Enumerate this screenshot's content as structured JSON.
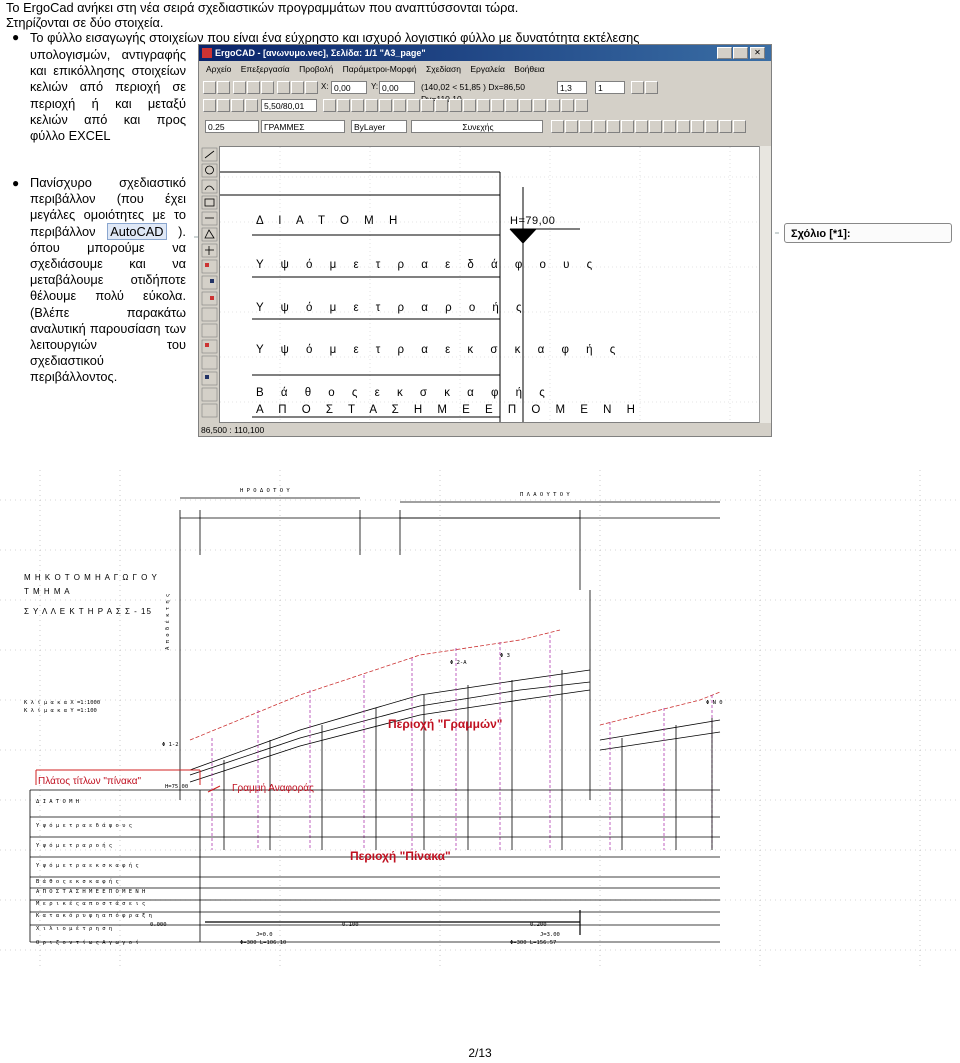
{
  "intro": {
    "line1": "Το ErgoCad  ανήκει στη νέα σειρά σχεδιαστικών προγραμμάτων που αναπτύσσονται τώρα.",
    "line2": "Στηρίζονται σε δύο στοιχεία.",
    "bullet1_first": "Το φύλλο εισαγωγής στοιχείων που είναι ένα εύχρηστο και ισχυρό λογιστικό φύλλο με δυνατότητα εκτέλεσης",
    "bullet1_rest": "υπολογισμών, αντιγραφής και επικόλλησης στοιχείων κελιών από περιοχή σε περιοχή ή και μεταξύ κελιών από και προς φύλλο EXCEL",
    "bullet2_pre": "Πανίσχυρο σχεδιαστικό περιβάλλον (που έχει μεγάλες ομοιότητες με το περιβάλλον",
    "bullet2_hl": "AutoCAD",
    "bullet2_post": "). όπου μπορούμε να σχεδιάσουμε και να μεταβάλουμε οτιδήποτε θέλουμε πολύ εύκολα. (Βλέπε παρακάτω αναλυτική παρουσίαση των λειτουργιών του σχεδιαστικού περιβάλλοντος."
  },
  "comment": "Σχόλιο [*1]:",
  "cad": {
    "title": "ErgoCAD - [ανωνυμο.vec], Σελίδα: 1/1 \"A3_page\"",
    "menu": [
      "Αρχείο",
      "Επεξεργασία",
      "Προβολή",
      "Παράμετροι-Μορφή",
      "Σχεδίαση",
      "Εργαλεία",
      "Βοήθεια"
    ],
    "x_field": "0,00",
    "y_field": "0,00",
    "coords": "(140,02 < 51,85 ) Dx=86,50 Dy=110,10",
    "scale": "5,50/80,01",
    "spin1": "1,3",
    "spin2": "1",
    "lineweight": "0.25",
    "layer": "ΓΡΑΜΜΕΣ",
    "color": "ByLayer",
    "linetype": "Συνεχής",
    "status": "86,500 : 110,100",
    "height_label": "H=79,00",
    "rows": [
      "Δ Ι Α Τ Ο Μ Η",
      "Υ ψ ό μ ε τ ρ α ε δ ά φ ο υ ς",
      "Υ ψ ό μ ε τ ρ α ρ ο ή ς",
      "Υ ψ ό μ ε τ ρ α ε κ σ κ α φ ή ς",
      "Β ά θ ο ς ε κ σ κ α φ ή ς",
      "Α Π Ο Σ Τ Α Σ Η  Μ Ε  Ε Π Ο Μ Ε Ν Η"
    ]
  },
  "drawing": {
    "title1": "Μ Η Κ Ο Τ Ο Μ Η  Α Γ Ω Γ Ο Υ",
    "title2": "Τ Μ Η Μ Α",
    "title3": "Σ Υ Λ Λ Ε Κ Τ Η Ρ Α Σ  Σ - 15",
    "scale1": "Κ λ ί μ α κ α  Χ =1:1000",
    "scale2": "Κ λ ί μ α κ α  Υ =1:100",
    "side_label": "Α π ο δ έ κ τ η ς",
    "road1": "Η Ρ Ο Δ Ο Τ Ο Υ",
    "road2": "Π Λ Α Ο Υ Τ Ο Υ",
    "annot_lines": "Περιοχή \"Γραμμών\"",
    "annot_table": "Περιοχή \"Πίνακα\"",
    "annot_width": "Πλάτος τίτλων \"πίνακα\"",
    "annot_ref": "Γραμμή Αναφοράς",
    "ref_h": "H=75.00",
    "table_rows": [
      "Δ Ι Α Τ Ο Μ Η",
      "Υ ψ ό μ ε τ ρ α ε δ ά φ ο υ ς",
      "Υ ψ ό μ ε τ ρ α ρ ο ή ς",
      "Υ ψ ό μ ε τ ρ α ε κ σ κ α φ ή ς",
      "Β ά θ ο ς ε κ σ κ α φ ή ς",
      "Α Π Ο Σ Τ Α Σ Η  Μ Ε  Ε Π Ο Μ Ε Ν Η",
      "Μ ε ρ ι κ έ ς α π ο σ τ ά σ ε ι ς",
      "Κ α τ α κ ό ρ υ φ η  α π ό φ ρ α ξ η",
      "Χ ι λ ι ο μ έ τ ρ η σ η",
      "Ο ρ ι ζ ο ν τ ί ω ς  Α γ ω γ ο ί"
    ],
    "km1": "0.000",
    "km2": "0.100",
    "km3": "0.200",
    "pipe1a": "J=0.0",
    "pipe1b": "Φ=300  L=106.10",
    "pipe2a": "J=3.00",
    "pipe2b": "Φ=300  L=156.57",
    "node_right": "Φ 2-Α",
    "node_mid": "Φ 3",
    "node_left": "Φ 1-2",
    "node_end": "Φ N 0"
  },
  "page_number": "2/13"
}
